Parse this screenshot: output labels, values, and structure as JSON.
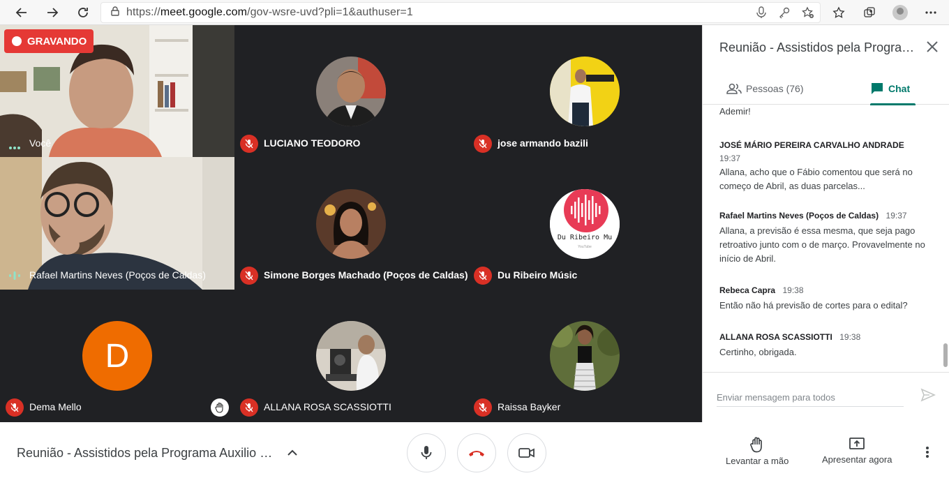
{
  "browser": {
    "url_prefix": "https://",
    "url_host": "meet.google.com",
    "url_path": "/gov-wsre-uvd?pli=1&authuser=1"
  },
  "recording": {
    "label": "GRAVANDO"
  },
  "tiles": [
    {
      "name": "Você"
    },
    {
      "name": "LUCIANO TEODORO"
    },
    {
      "name": "jose armando bazili"
    },
    {
      "name": "Rafael Martins Neves (Poços de Caldas)"
    },
    {
      "name": "Simone Borges Machado (Poços de Caldas)"
    },
    {
      "name": "Du Ribeiro Músic",
      "avatar_text": "Du Ribeiro Mu",
      "avatar_sub": "YouTube"
    },
    {
      "name": "Dema Mello",
      "avatar_letter": "D"
    },
    {
      "name": "ALLANA ROSA SCASSIOTTI"
    },
    {
      "name": "Raissa Bayker"
    }
  ],
  "panel": {
    "title": "Reunião - Assistidos pela Programa Auxilio E...",
    "tabs": {
      "people": "Pessoas (76)",
      "chat": "Chat"
    },
    "messages": [
      {
        "text": "Ademir!"
      },
      {
        "sender": "JOSÉ MÁRIO PEREIRA CARVALHO ANDRADE",
        "time": "19:37",
        "text": "Allana, acho que o Fábio comentou que será no começo de Abril, as duas parcelas..."
      },
      {
        "sender": "Rafael Martins Neves (Poços de Caldas)",
        "time": "19:37",
        "text": "Allana, a previsão é essa mesma, que seja pago retroativo junto com o de março. Provavelmente no início de Abril."
      },
      {
        "sender": "Rebeca Capra",
        "time": "19:38",
        "text": "Então não há previsão de cortes para o edital?"
      },
      {
        "sender": "ALLANA ROSA SCASSIOTTI",
        "time": "19:38",
        "text": "Certinho, obrigada."
      }
    ],
    "compose_placeholder": "Enviar mensagem para todos"
  },
  "bottom": {
    "meeting_title": "Reunião - Assistidos pela Programa Auxilio E...",
    "raise_hand": "Levantar a mão",
    "present": "Apresentar agora"
  },
  "colors": {
    "recording": "#e53935",
    "mic_off": "#d93025",
    "accent": "#00796b",
    "dema_avatar": "#ef6c00"
  }
}
